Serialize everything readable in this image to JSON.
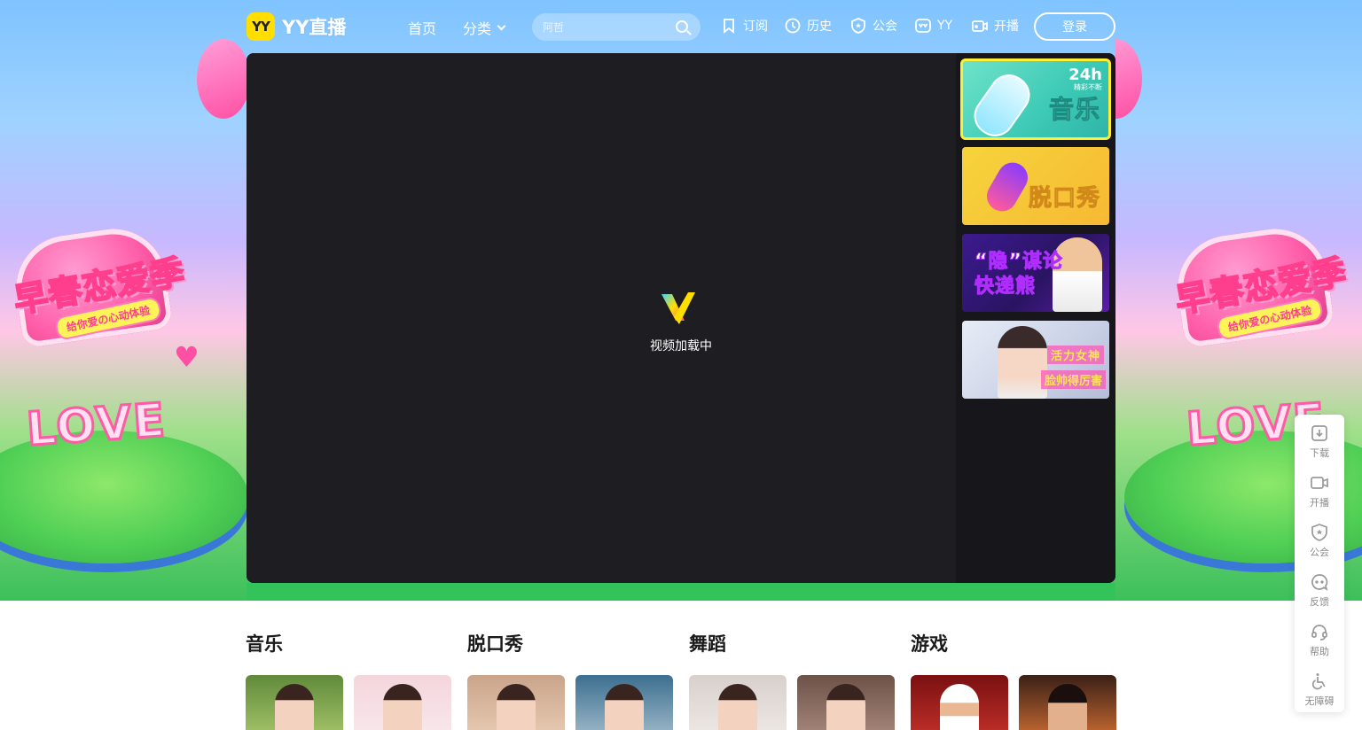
{
  "header": {
    "logo_mark": "YY",
    "logo_text": "YY直播",
    "nav_home": "首页",
    "nav_category": "分类",
    "search_placeholder": "阿哲",
    "subscribe": "订阅",
    "history": "历史",
    "guild": "公会",
    "yy": "YY",
    "go_live": "开播",
    "login": "登录"
  },
  "hero": {
    "deco_title": "早春恋爱季",
    "deco_subtitle": "给你爱の心动体验",
    "deco_love": "LOVE"
  },
  "player": {
    "loading_text": "视频加载中"
  },
  "recommend": [
    {
      "title": "音乐",
      "badge": "24h",
      "badge_sub": "精彩不断",
      "active": true
    },
    {
      "title": "脱口秀",
      "active": false
    },
    {
      "title": "“隐”谋论 快递熊",
      "active": false
    },
    {
      "title": "活力女神",
      "title2": "脸帅得厉害",
      "active": false
    }
  ],
  "sidebar": {
    "download": "下载",
    "go_live": "开播",
    "guild": "公会",
    "feedback": "反馈",
    "help": "帮助",
    "accessibility": "无障碍"
  },
  "categories": [
    {
      "title": "音乐"
    },
    {
      "title": "脱口秀"
    },
    {
      "title": "舞蹈"
    },
    {
      "title": "游戏"
    }
  ],
  "colors": {
    "accent_yellow": "#ffde00",
    "active_outline": "#ffee33",
    "player_bg": "#1c1c21"
  }
}
